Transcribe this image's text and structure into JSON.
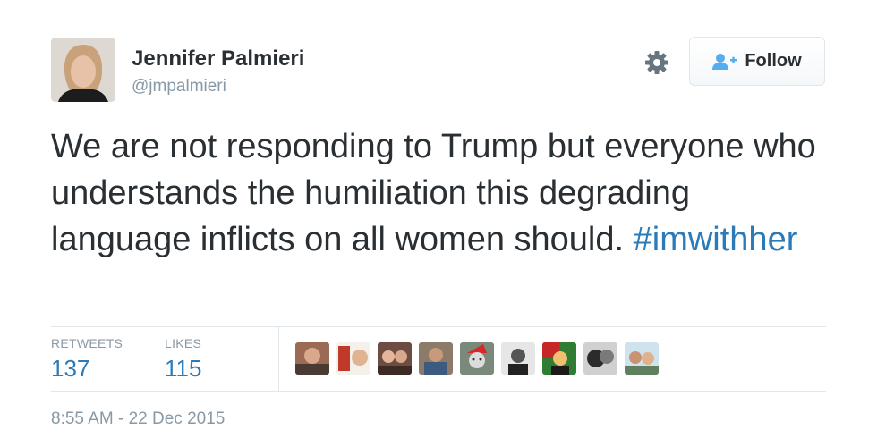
{
  "author": {
    "name": "Jennifer Palmieri",
    "handle": "@jmpalmieri"
  },
  "actions": {
    "follow_label": "Follow",
    "settings_icon": "gear-icon",
    "follow_icon": "add-user-icon"
  },
  "tweet": {
    "text": "We are not responding to Trump but everyone who understands the humiliation this degrading language inflicts on all women should.",
    "hashtag": "#imwithher"
  },
  "stats": {
    "retweets_label": "RETWEETS",
    "retweets_count": "137",
    "likes_label": "LIKES",
    "likes_count": "115"
  },
  "timestamp": "8:55 AM - 22 Dec 2015",
  "colors": {
    "text": "#292f33",
    "secondary": "#8899a6",
    "link": "#2b7bb9",
    "border": "#e1e8ed"
  }
}
